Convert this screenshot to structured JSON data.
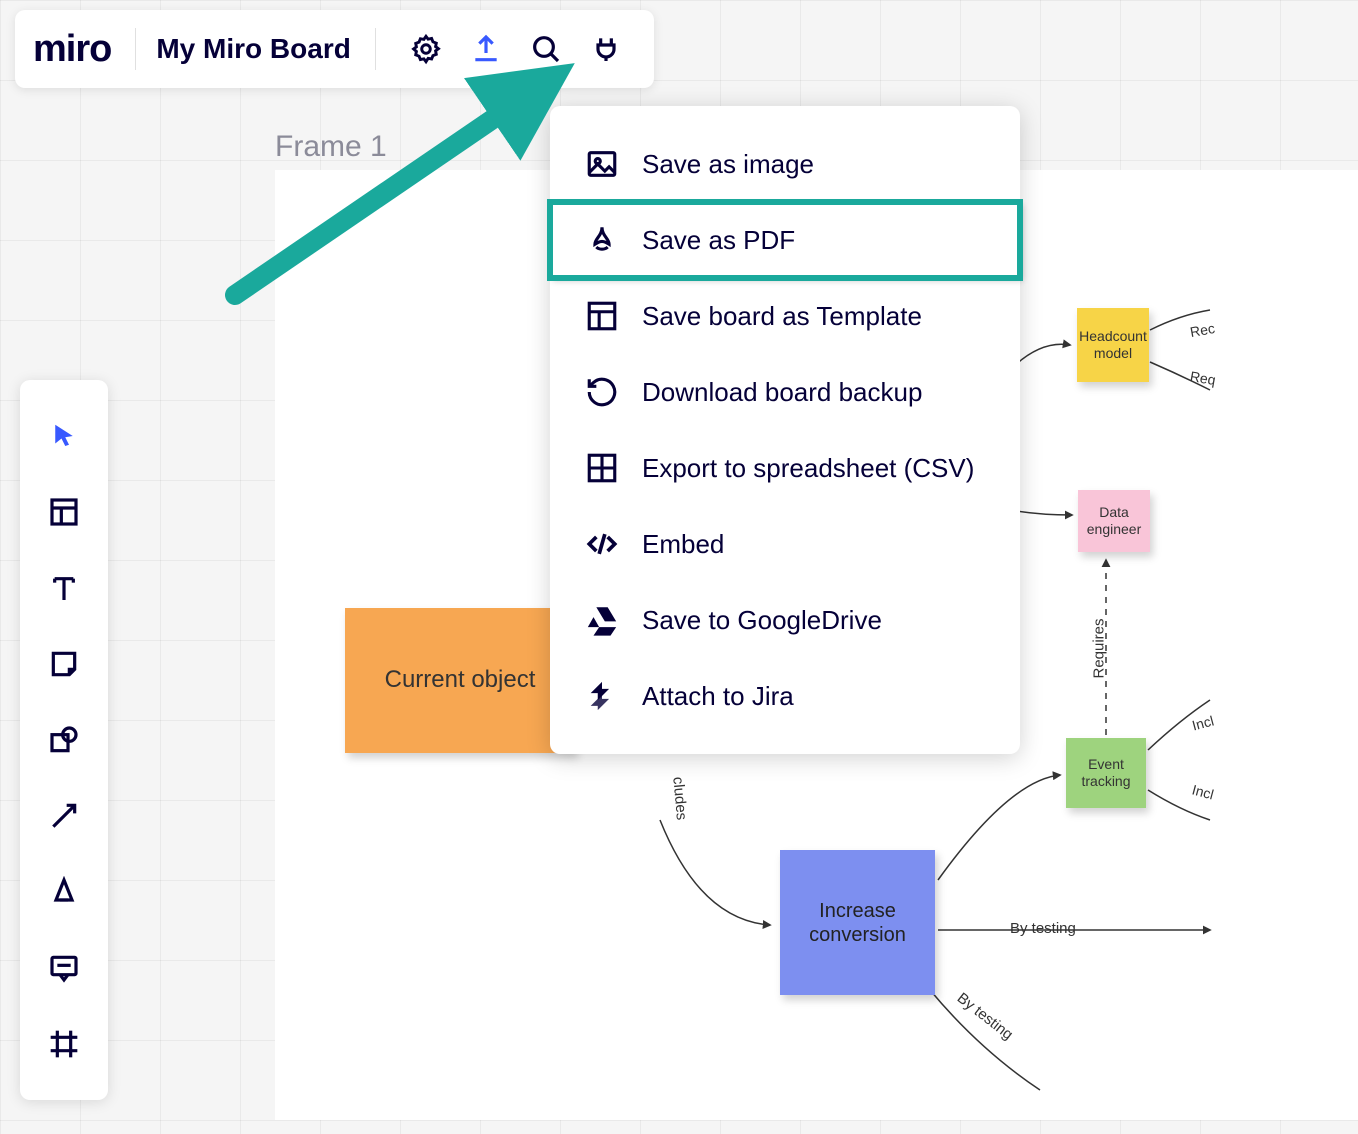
{
  "header": {
    "logo_text": "miro",
    "board_title": "My Miro Board"
  },
  "frame": {
    "label": "Frame 1"
  },
  "export_menu": {
    "items": [
      {
        "icon": "image-icon",
        "label": "Save as image"
      },
      {
        "icon": "pdf-icon",
        "label": "Save as PDF",
        "highlighted": true
      },
      {
        "icon": "template-icon",
        "label": "Save board as Template"
      },
      {
        "icon": "backup-icon",
        "label": "Download board backup"
      },
      {
        "icon": "spreadsheet-icon",
        "label": "Export to spreadsheet (CSV)"
      },
      {
        "icon": "embed-icon",
        "label": "Embed"
      },
      {
        "icon": "google-drive-icon",
        "label": "Save to GoogleDrive"
      },
      {
        "icon": "jira-icon",
        "label": "Attach to Jira"
      }
    ]
  },
  "toolbar": {
    "tools": [
      "cursor",
      "template",
      "text",
      "sticky-note",
      "shape",
      "connector",
      "pen",
      "comment",
      "frame"
    ]
  },
  "stickies": {
    "orange": "Current object",
    "yellow": "Headcount model",
    "pink": "Data engineer",
    "green": "Event tracking",
    "blue": "Increase conversion"
  },
  "edge_labels": {
    "includes": "cludes",
    "requires": "Requires",
    "by_testing": "By testing",
    "by_testing2": "By testing",
    "rec1": "Rec",
    "rec2": "Req",
    "incl1": "Incl",
    "incl2": "Incl"
  },
  "annotation": {
    "arrow_color": "#1aa99c"
  }
}
